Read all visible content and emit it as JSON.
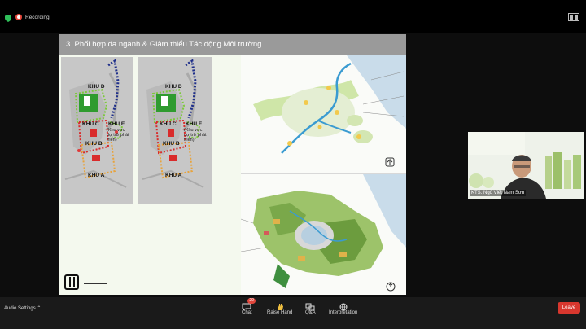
{
  "topbar": {
    "recording_label": "Recording"
  },
  "slide": {
    "title": "3. Phối hợp đa ngành &  Giảm thiểu Tác động Môi trường",
    "left_map": {
      "khu_d": "KHU D",
      "khu_c": "KHU C",
      "khu_e": "KHU E",
      "khu_e_sub": "(Khu vực dự trữ phát triển)",
      "khu_b": "KHU B",
      "khu_a": "KHU A"
    },
    "right_map": {
      "khu_d": "KHU D",
      "khu_c": "KHU C",
      "khu_e": "KHU E",
      "khu_e_sub": "(Khu vực dự trữ phát triển)",
      "khu_b": "KHU B",
      "khu_a": "KHU A"
    }
  },
  "video": {
    "speaker_name": "KTS. Ngô Viết Nam Sơn"
  },
  "toolbar": {
    "audio_settings": "Audio Settings",
    "chat_label": "Chat",
    "chat_badge": "20",
    "raise_hand_label": "Raise Hand",
    "qa_label": "Q&A",
    "interpretation_label": "Interpretation",
    "leave_label": "Leave"
  },
  "colors": {
    "recording": "#e5483c",
    "leave": "#d8372e",
    "slide_title_bar": "#9a9a9a"
  }
}
